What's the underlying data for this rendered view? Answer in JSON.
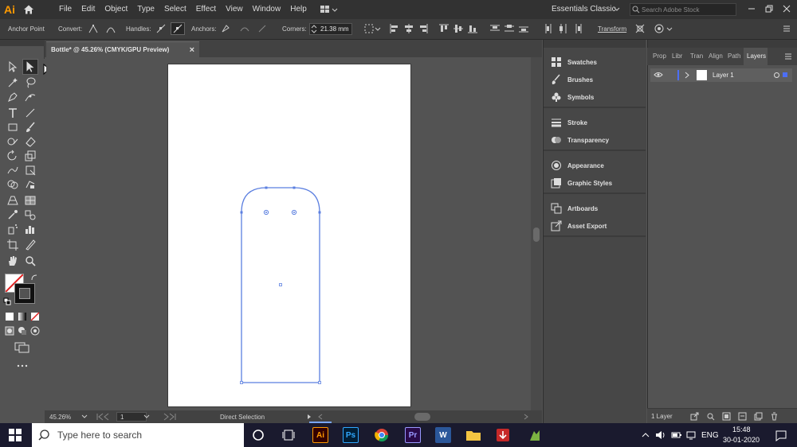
{
  "menu": {
    "logo": "Ai",
    "items": [
      "File",
      "Edit",
      "Object",
      "Type",
      "Select",
      "Effect",
      "View",
      "Window",
      "Help"
    ],
    "workspace": "Essentials Classic",
    "search_placeholder": "Search Adobe Stock"
  },
  "control": {
    "mode_label": "Anchor Point",
    "convert_label": "Convert:",
    "handles_label": "Handles:",
    "anchors_label": "Anchors:",
    "corners_label": "Corners:",
    "corners_value": "21.38 mm",
    "transform_label": "Transform"
  },
  "document": {
    "tab_title": "Bottle* @ 45.26% (CMYK/GPU Preview)",
    "close_glyph": "×"
  },
  "status": {
    "zoom": "45.26%",
    "artboard_num": "1",
    "tool_name": "Direct Selection"
  },
  "panels": {
    "items": [
      {
        "label": "Swatches",
        "icon": "swatches-icon"
      },
      {
        "label": "Brushes",
        "icon": "brushes-icon"
      },
      {
        "label": "Symbols",
        "icon": "symbols-icon"
      },
      {
        "label": "Stroke",
        "icon": "stroke-icon"
      },
      {
        "label": "Transparency",
        "icon": "transparency-icon"
      },
      {
        "label": "Appearance",
        "icon": "appearance-icon"
      },
      {
        "label": "Graphic Styles",
        "icon": "graphic-styles-icon"
      },
      {
        "label": "Artboards",
        "icon": "artboards-icon"
      },
      {
        "label": "Asset Export",
        "icon": "asset-export-icon"
      }
    ]
  },
  "layers": {
    "tabs": [
      "Prop",
      "Libr",
      "Tran",
      "Align",
      "Path",
      "Layers"
    ],
    "active_tab": "Layers",
    "layer_name": "Layer 1",
    "footer_count": "1 Layer"
  },
  "taskbar": {
    "search_placeholder": "Type here to search",
    "lang": "ENG",
    "time": "15:48",
    "date": "30-01-2020",
    "apps": [
      {
        "label": "Ai",
        "color": "#ff9a00",
        "bg": "#330000"
      },
      {
        "label": "Ps",
        "color": "#31a8ff",
        "bg": "#001e36"
      },
      {
        "label": "Pr",
        "color": "#9999ff",
        "bg": "#2a0a4a"
      },
      {
        "label": "W",
        "color": "#ffffff",
        "bg": "#2b579a"
      }
    ]
  },
  "colors": {
    "path_blue": "#5b7fe0",
    "ai_orange": "#ff9a00"
  }
}
